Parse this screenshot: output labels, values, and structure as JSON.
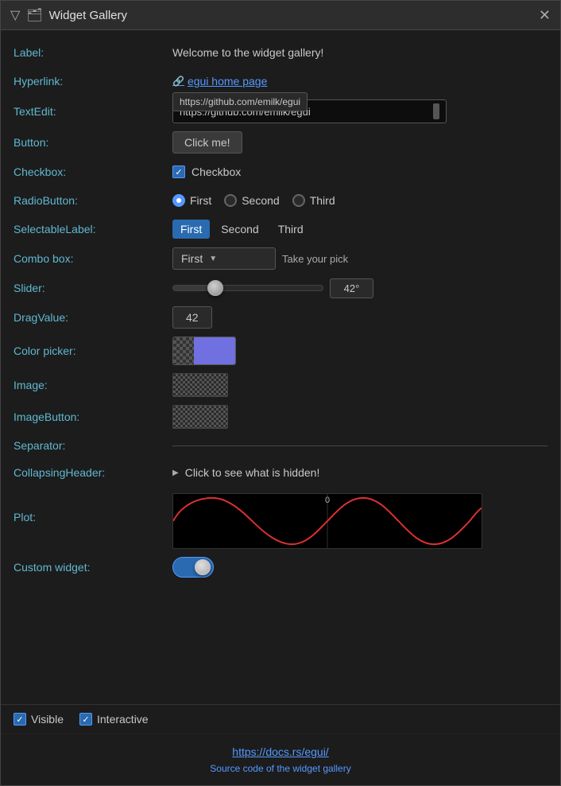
{
  "window": {
    "title": "Widget Gallery",
    "icon": "🗂",
    "menu_icon": "▽",
    "close_icon": "✕"
  },
  "rows": {
    "label_label": "Label:",
    "label_value": "Welcome to the widget gallery!",
    "hyperlink_label": "Hyperlink:",
    "hyperlink_text": "egui home page",
    "hyperlink_tooltip": "https://github.com/emilk/egui",
    "textedit_label": "TextEdit:",
    "textedit_value": "https://github.com/emilk/egui",
    "button_label": "Button:",
    "button_text": "Click me!",
    "checkbox_label": "Checkbox:",
    "checkbox_text": "Checkbox",
    "radiobutton_label": "RadioButton:",
    "radio_options": [
      "First",
      "Second",
      "Third"
    ],
    "selectable_label": "SelectableLabel:",
    "selectable_options": [
      "First",
      "Second",
      "Third"
    ],
    "combobox_label": "Combo box:",
    "combo_selected": "First",
    "combo_hint": "Take your pick",
    "slider_label": "Slider:",
    "slider_value": "42°",
    "slider_percent": 28,
    "dragvalue_label": "DragValue:",
    "dragvalue_value": "42",
    "colorpicker_label": "Color picker:",
    "image_label": "Image:",
    "imagebutton_label": "ImageButton:",
    "separator_label": "Separator:",
    "collapsing_label": "CollapsingHeader:",
    "collapsing_text": "Click to see what is hidden!",
    "plot_label": "Plot:",
    "plot_zero_label": "0",
    "custom_widget_label": "Custom widget:"
  },
  "footer": {
    "visible_label": "Visible",
    "interactive_label": "Interactive",
    "docs_link": "https://docs.rs/egui/",
    "source_link": "Source code of the widget gallery"
  },
  "colors": {
    "accent": "#60b8d0",
    "link": "#5599ff",
    "bg": "#1c1c1c",
    "row_bg": "#2a2a2a",
    "selected_radio": "#5599ff",
    "selected_label_bg": "#2a6ab0",
    "toggle_bg": "#2a6ab0",
    "plot_line": "#e03030"
  }
}
